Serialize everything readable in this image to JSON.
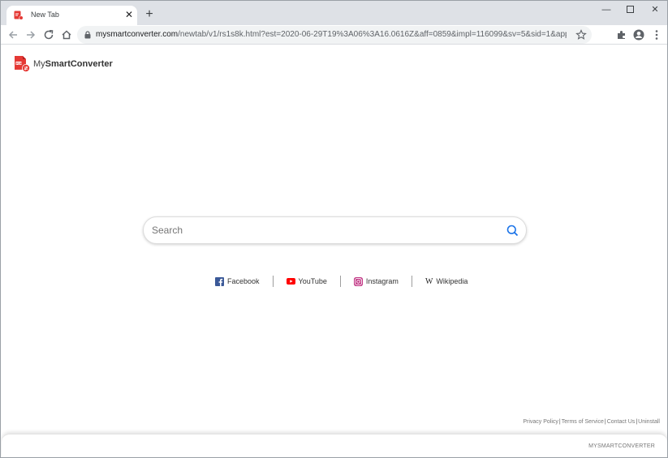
{
  "browser": {
    "tab_title": "New Tab",
    "url_host": "mysmartconverter.com",
    "url_path": "/newtab/v1/rs1s8k.html?est=2020-06-29T19%3A06%3A16.0616Z&aff=0859&impl=116099&sv=5&sid=1&appId=..."
  },
  "brand": {
    "name_prefix": "My",
    "name_bold": "SmartConverter"
  },
  "search": {
    "placeholder": "Search"
  },
  "quick_links": [
    {
      "label": "Facebook",
      "icon": "facebook-icon"
    },
    {
      "label": "YouTube",
      "icon": "youtube-icon"
    },
    {
      "label": "Instagram",
      "icon": "instagram-icon"
    },
    {
      "label": "Wikipedia",
      "icon": "wikipedia-icon"
    }
  ],
  "footer": {
    "links": [
      "Privacy Policy",
      "Terms of Service",
      "Contact Us",
      "Uninstall"
    ],
    "brand": "MYSMARTCONVERTER"
  },
  "colors": {
    "accent": "#1a73e8",
    "brand_red": "#e53935"
  }
}
